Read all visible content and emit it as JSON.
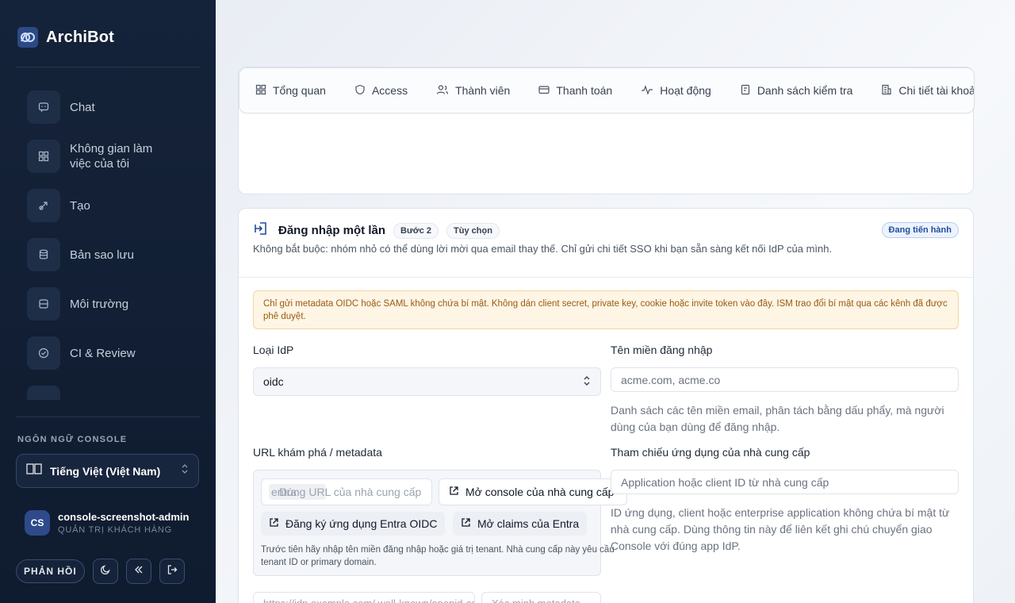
{
  "app": {
    "name": "ArchiBot"
  },
  "sidebar": {
    "items": [
      {
        "label": "Chat",
        "icon": "chat-icon"
      },
      {
        "label": "Không gian làm việc của tôi",
        "icon": "grid-icon"
      },
      {
        "label": "Tạo",
        "icon": "rocket-icon"
      },
      {
        "label": "Bản sao lưu",
        "icon": "database-icon"
      },
      {
        "label": "Môi trường",
        "icon": "server-icon"
      },
      {
        "label": "CI & Review",
        "icon": "check-circle-icon"
      }
    ],
    "language_title": "NGÔN NGỮ CONSOLE",
    "language_value": "Tiếng Việt (Việt Nam)",
    "user": {
      "initials": "CS",
      "name": "console-screenshot-admin",
      "role": "QUẢN TRỊ KHÁCH HÀNG"
    },
    "feedback_label": "PHẢN HỒI"
  },
  "tabs": [
    {
      "label": "Tổng quan",
      "icon": "overview-icon"
    },
    {
      "label": "Access",
      "icon": "shield-icon"
    },
    {
      "label": "Thành viên",
      "icon": "users-icon"
    },
    {
      "label": "Thanh toán",
      "icon": "credit-card-icon"
    },
    {
      "label": "Hoạt động",
      "icon": "activity-icon"
    },
    {
      "label": "Danh sách kiểm tra",
      "icon": "checklist-icon"
    },
    {
      "label": "Chi tiết tài khoản",
      "icon": "building-icon"
    }
  ],
  "sso": {
    "title": "Đăng nhập một lần",
    "step": "Bước 2",
    "optional": "Tùy chọn",
    "status": "Đang tiến hành",
    "description": "Không bắt buộc: nhóm nhỏ có thể dùng lời mời qua email thay thế. Chỉ gửi chi tiết SSO khi bạn sẵn sàng kết nối IdP của mình.",
    "warning": "Chỉ gửi metadata OIDC hoặc SAML không chứa bí mật. Không dán client secret, private key, cookie hoặc invite token vào đây. ISM trao đổi bí mật qua các kênh đã được phê duyệt.",
    "idp_type_label": "Loại IdP",
    "idp_type_value": "oidc",
    "domain_label": "Tên miền đăng nhập",
    "domain_placeholder": "acme.com, acme.co",
    "domain_help": "Danh sách các tên miền email, phân tách bằng dấu phẩy, mà người dùng của bạn dùng để đăng nhập.",
    "url_label": "URL khám phá / metadata",
    "url_input_prefix": "entra",
    "url_input_placeholder": "Dùng URL của nhà cung cấp",
    "open_console": "Mở console của nhà cung cấp",
    "register_entra": "Đăng ký ứng dụng Entra OIDC",
    "open_claims": "Mở claims của Entra",
    "url_help": "Trước tiên hãy nhập tên miền đăng nhập hoặc giá trị tenant. Nhà cung cấp này yêu cầu tenant ID or primary domain.",
    "app_ref_label": "Tham chiếu ứng dụng của nhà cung cấp",
    "app_ref_placeholder": "Application hoặc client ID từ nhà cung cấp",
    "app_ref_help": "ID ứng dụng, client hoặc enterprise application không chứa bí mật từ nhà cung cấp. Dùng thông tin này để liên kết ghi chú chuyển giao Console với đúng app IdP.",
    "discovery_placeholder": "https://idp.example.com/.well-known/openid-configuration",
    "metadata_placeholder": "Xác minh metadata"
  }
}
